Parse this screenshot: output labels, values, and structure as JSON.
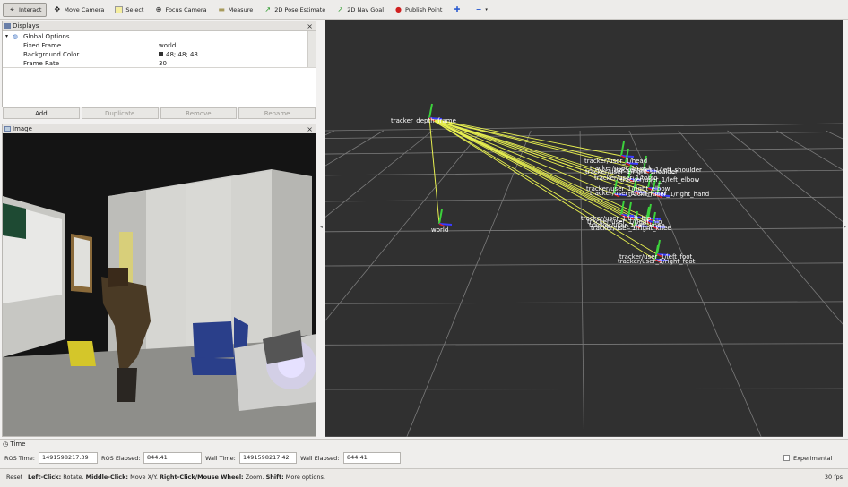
{
  "toolbar": {
    "tools": [
      {
        "label": "Interact",
        "icon": "interact-icon",
        "glyph": "⌖"
      },
      {
        "label": "Move Camera",
        "icon": "move-camera-icon",
        "glyph": "✥"
      },
      {
        "label": "Select",
        "icon": "select-icon",
        "glyph": "▭"
      },
      {
        "label": "Focus Camera",
        "icon": "focus-camera-icon",
        "glyph": "⊕"
      },
      {
        "label": "Measure",
        "icon": "measure-icon",
        "glyph": "▬"
      },
      {
        "label": "2D Pose Estimate",
        "icon": "pose-estimate-icon",
        "glyph": "↗"
      },
      {
        "label": "2D Nav Goal",
        "icon": "nav-goal-icon",
        "glyph": "↗"
      },
      {
        "label": "Publish Point",
        "icon": "publish-point-icon",
        "glyph": "●"
      }
    ],
    "plus": "✚",
    "minus": "−"
  },
  "displays": {
    "title": "Displays",
    "close": "×",
    "rows": [
      {
        "key": "Global Options",
        "value": ""
      },
      {
        "key": "Fixed Frame",
        "value": "world"
      },
      {
        "key": "Background Color",
        "value": "48; 48; 48"
      },
      {
        "key": "Frame Rate",
        "value": "30"
      }
    ],
    "buttons": {
      "add": "Add",
      "duplicate": "Duplicate",
      "remove": "Remove",
      "rename": "Rename"
    }
  },
  "image_panel": {
    "title": "Image",
    "close": "×"
  },
  "viewport": {
    "labels": [
      "tracker_depth_frame",
      "world",
      "tracker/user_1/head",
      "tracker/user_1/neck",
      "tracker/user_1/left_shoulder",
      "tracker/user_1/torso",
      "tracker/user_1/right_shoulder",
      "tracker/user_1/left_elbow",
      "tracker/user_1/right_elbow",
      "tracker/user_1/left_hand",
      "tracker/user_1/right_hand",
      "tracker/user_1/left_hip",
      "tracker/user_1/right_hip",
      "tracker/user_1/left_knee",
      "tracker/user_1/right_knee",
      "tracker/user_1/left_foot",
      "tracker/user_1/right_foot"
    ]
  },
  "time": {
    "title": "Time",
    "ros_time_label": "ROS Time:",
    "ros_time": "1491598217.39",
    "ros_elapsed_label": "ROS Elapsed:",
    "ros_elapsed": "844.41",
    "wall_time_label": "Wall Time:",
    "wall_time": "1491598217.42",
    "wall_elapsed_label": "Wall Elapsed:",
    "wall_elapsed": "844.41",
    "experimental": "Experimental"
  },
  "status": {
    "reset": "Reset",
    "left_click": "Left-Click:",
    "left_click_desc": " Rotate. ",
    "middle_click": "Middle-Click:",
    "middle_click_desc": " Move X/Y. ",
    "right_click": "Right-Click/Mouse Wheel:",
    "right_click_desc": " Zoom. ",
    "shift": "Shift:",
    "shift_desc": " More options.",
    "fps": "30 fps"
  },
  "colors": {
    "viewport_bg": "#303030",
    "grid": "#7a7a7a",
    "link_line": "#e8f050",
    "axis_green": "#3cd23c",
    "axis_blue": "#3b3bff",
    "axis_red": "#e02020"
  }
}
